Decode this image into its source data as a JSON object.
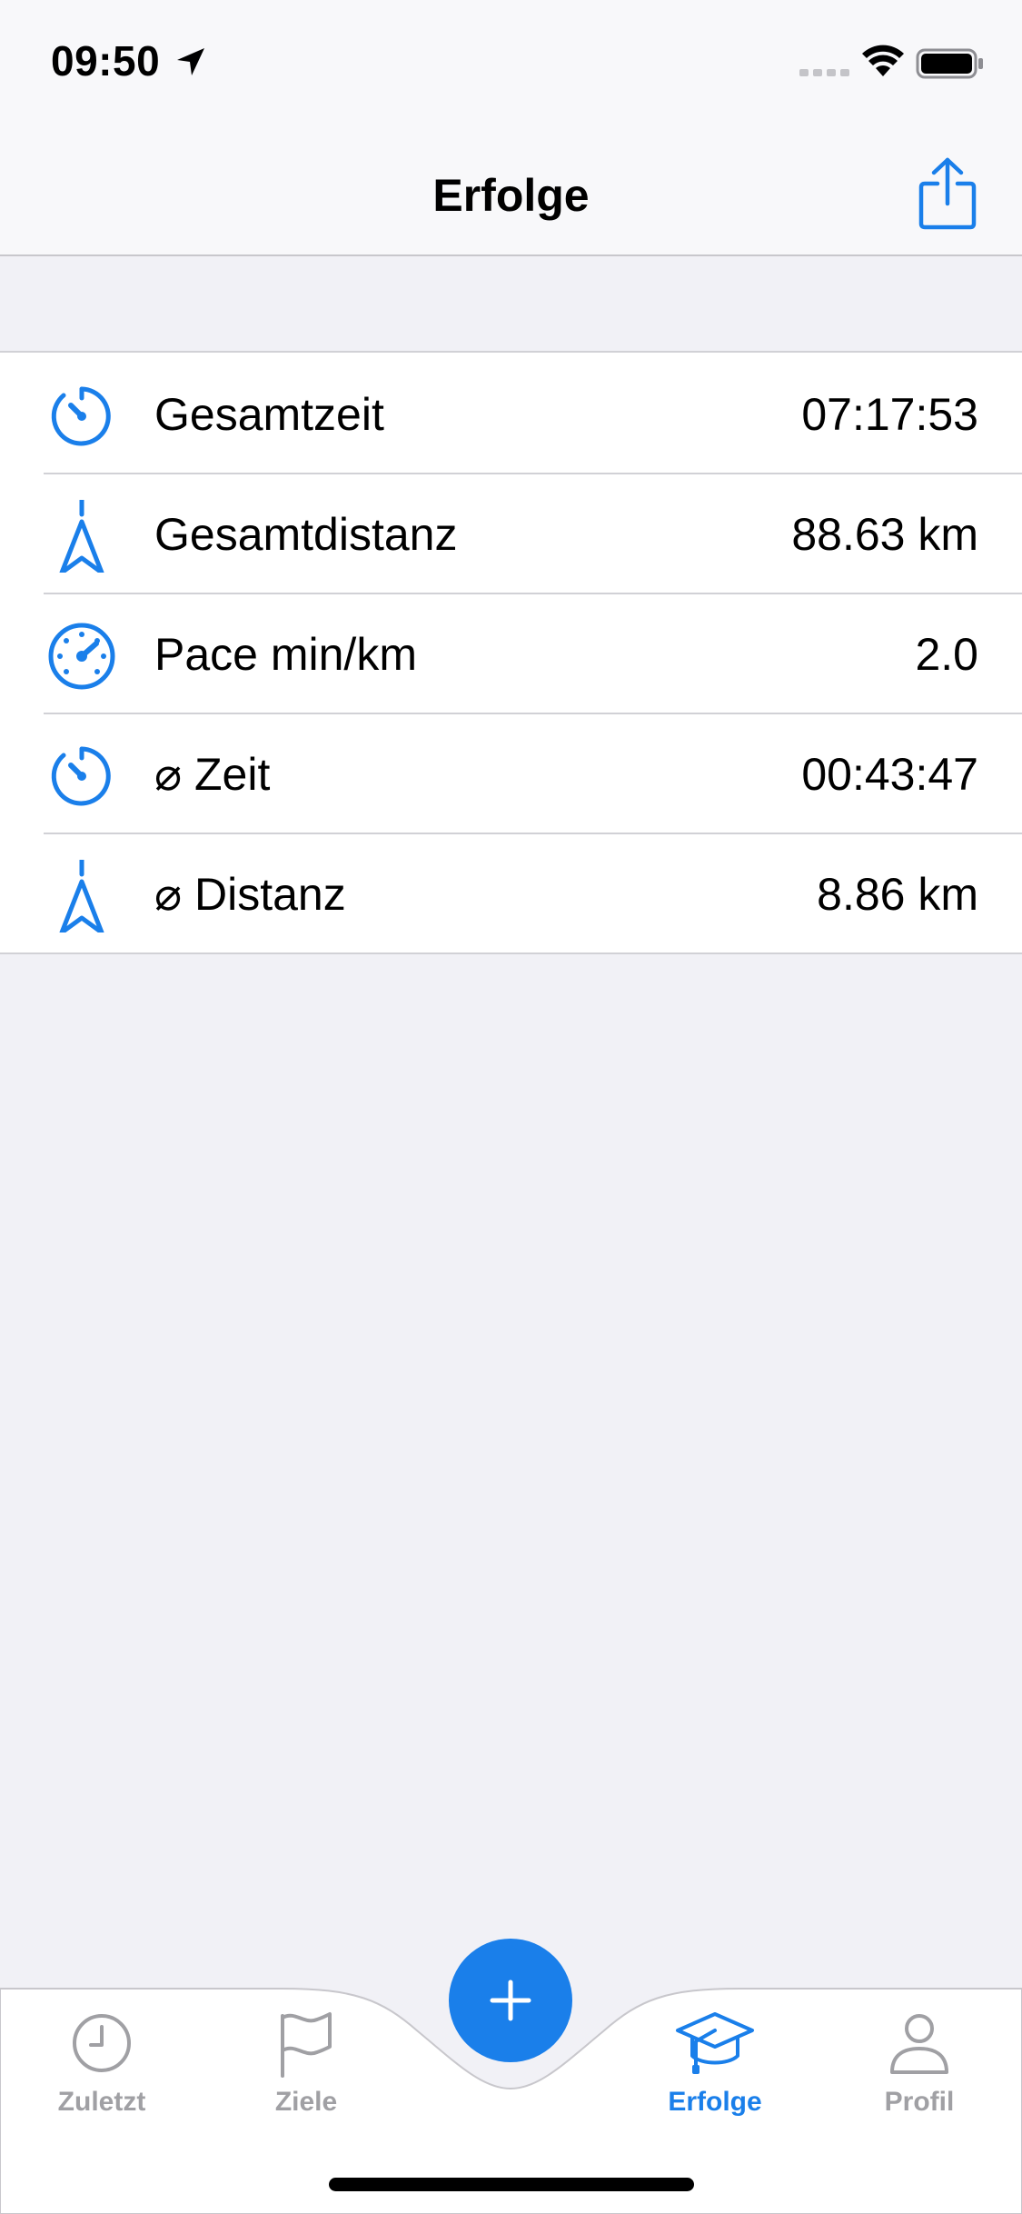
{
  "status_bar": {
    "time": "09:50"
  },
  "nav": {
    "title": "Erfolge",
    "share_icon": "share-icon"
  },
  "stats": [
    {
      "icon": "stopwatch-icon",
      "label": "Gesamtzeit",
      "value": "07:17:53"
    },
    {
      "icon": "navigation-arrow-icon",
      "label": "Gesamtdistanz",
      "value": "88.63 km"
    },
    {
      "icon": "speedometer-icon",
      "label": "Pace min/km",
      "value": "2.0"
    },
    {
      "icon": "stopwatch-icon",
      "label": "⌀ Zeit",
      "value": "00:43:47"
    },
    {
      "icon": "navigation-arrow-icon",
      "label": "⌀ Distanz",
      "value": "8.86 km"
    }
  ],
  "tab_bar": {
    "tabs": [
      {
        "label": "Zuletzt",
        "icon": "clock-icon",
        "active": false
      },
      {
        "label": "Ziele",
        "icon": "flag-icon",
        "active": false
      },
      {
        "label": "Erfolge",
        "icon": "graduation-cap-icon",
        "active": true
      },
      {
        "label": "Profil",
        "icon": "person-icon",
        "active": false
      }
    ],
    "add_icon": "plus-icon"
  },
  "colors": {
    "accent": "#1A7FEA",
    "background": "#F1F1F6",
    "inactive_tab": "#A0A0A4"
  }
}
